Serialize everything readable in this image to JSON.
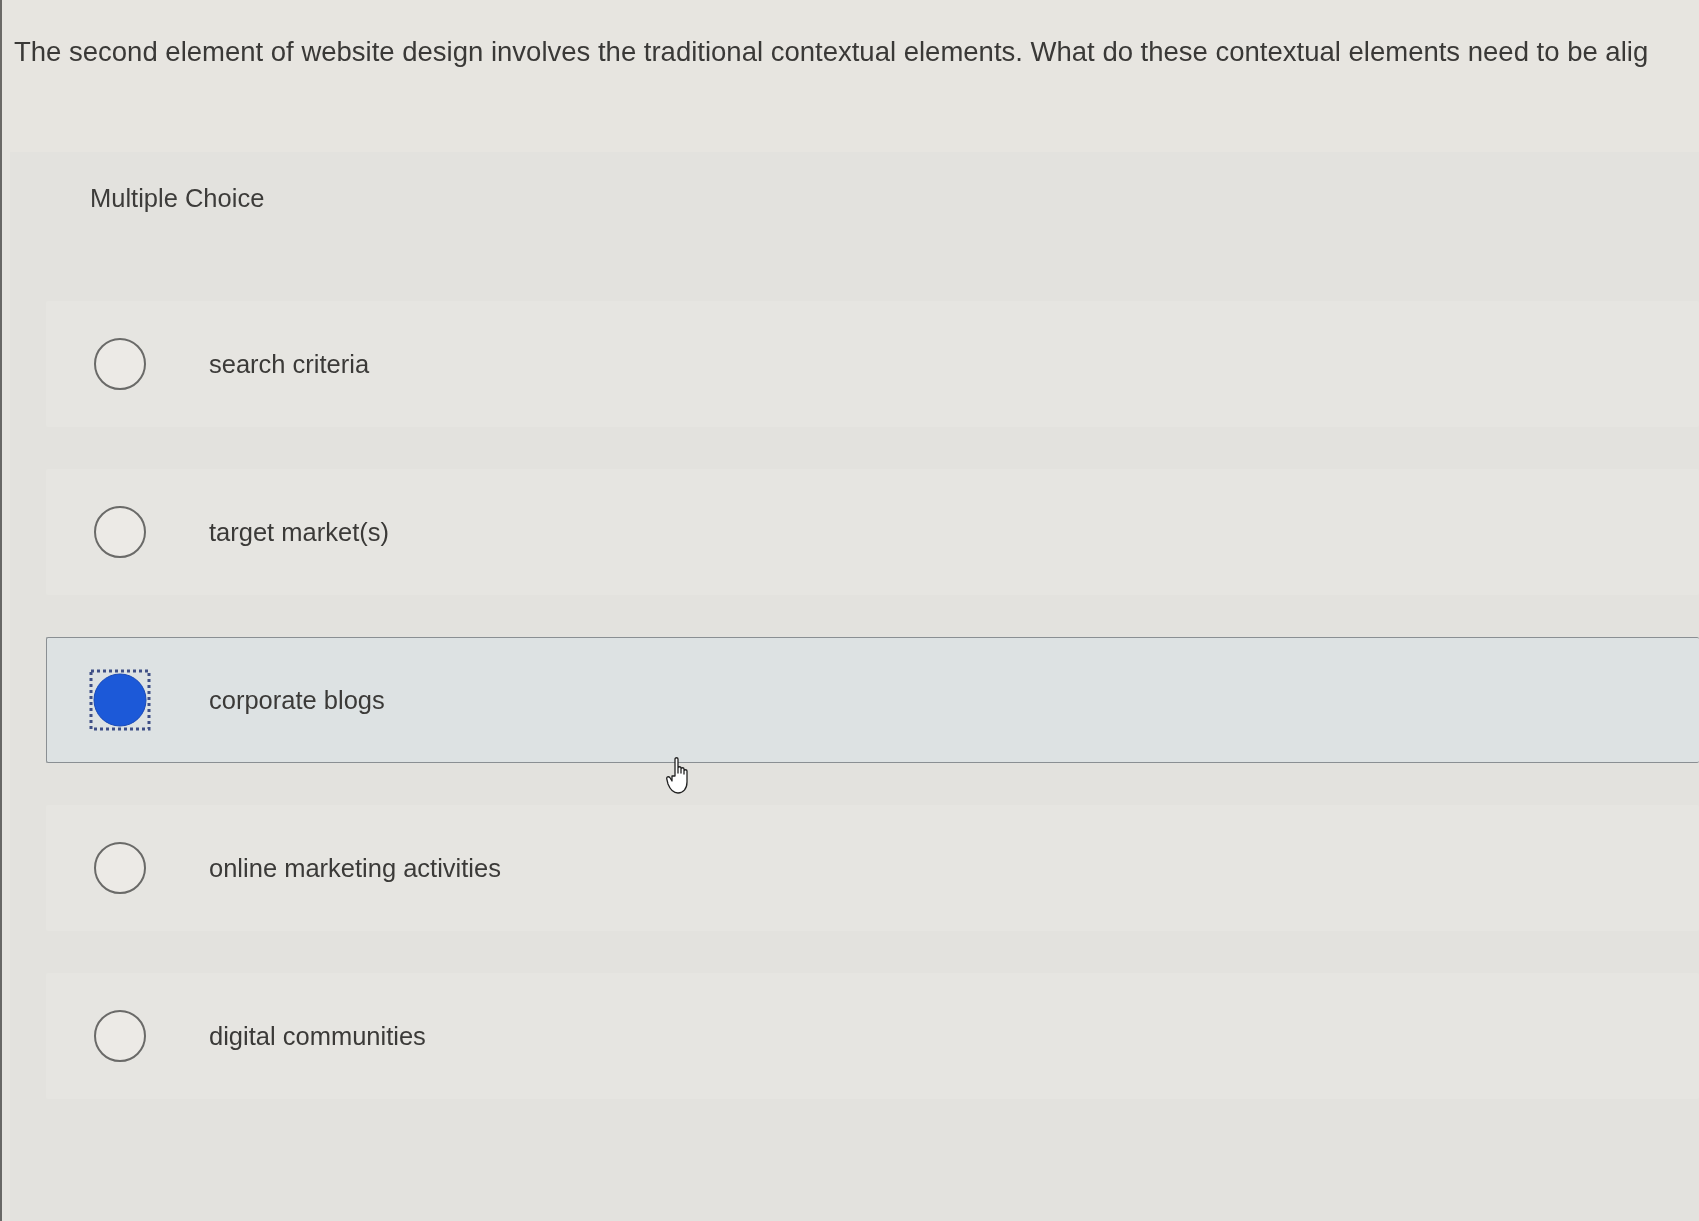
{
  "question": {
    "text": "The second element of website design involves the traditional contextual elements. What do these contextual elements need to be alig"
  },
  "question_type": "Multiple Choice",
  "options": [
    {
      "label": "search criteria",
      "selected": false
    },
    {
      "label": "target market(s)",
      "selected": false
    },
    {
      "label": "corporate blogs",
      "selected": true
    },
    {
      "label": "online marketing activities",
      "selected": false
    },
    {
      "label": "digital communities",
      "selected": false
    }
  ]
}
